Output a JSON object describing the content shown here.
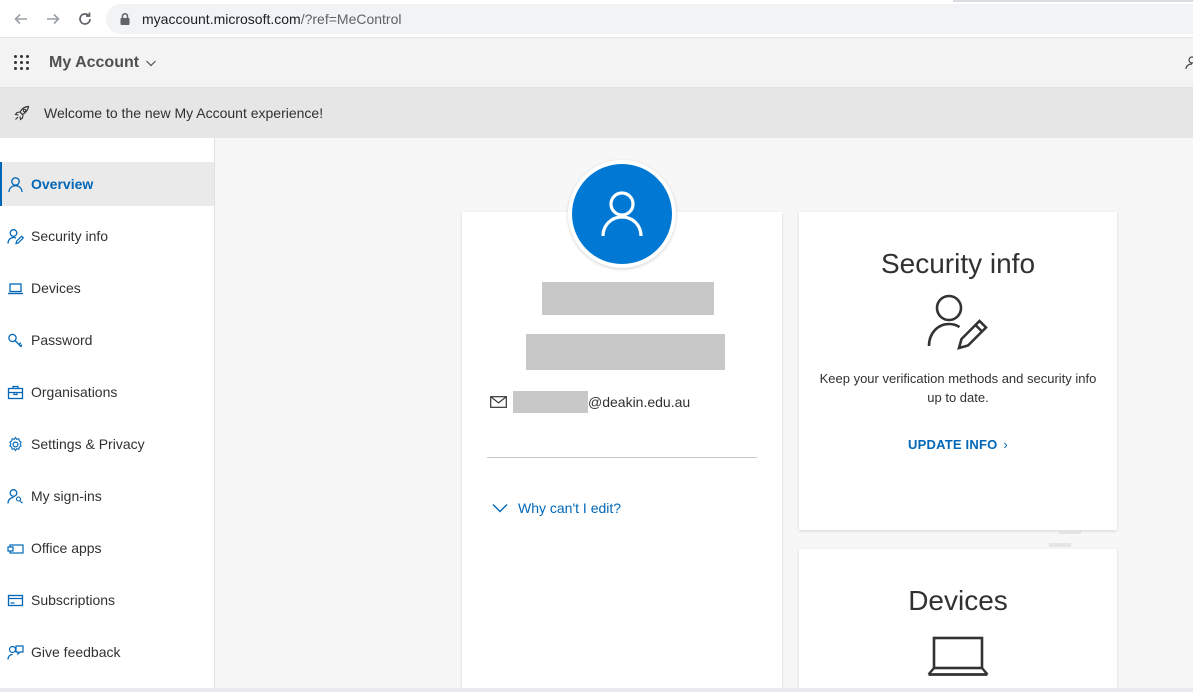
{
  "browser": {
    "url_host": "myaccount.microsoft.com",
    "url_rest": "/?ref=MeControl"
  },
  "header": {
    "app_title": "My Account"
  },
  "banner": {
    "text": "Welcome to the new My Account experience!"
  },
  "sidebar": {
    "items": [
      {
        "label": "Overview",
        "icon": "person-icon",
        "active": true
      },
      {
        "label": "Security info",
        "icon": "person-edit-icon"
      },
      {
        "label": "Devices",
        "icon": "laptop-icon"
      },
      {
        "label": "Password",
        "icon": "key-icon"
      },
      {
        "label": "Organisations",
        "icon": "briefcase-icon"
      },
      {
        "label": "Settings & Privacy",
        "icon": "gear-icon"
      },
      {
        "label": "My sign-ins",
        "icon": "person-key-icon"
      },
      {
        "label": "Office apps",
        "icon": "apps-icon"
      },
      {
        "label": "Subscriptions",
        "icon": "card-icon"
      },
      {
        "label": "Give feedback",
        "icon": "feedback-icon"
      }
    ]
  },
  "profile": {
    "email_domain": "@deakin.edu.au",
    "why_edit": "Why can't I edit?"
  },
  "security_card": {
    "title": "Security info",
    "description": "Keep your verification methods and security info up to date.",
    "link": "UPDATE INFO"
  },
  "devices_card": {
    "title": "Devices"
  },
  "colors": {
    "accent": "#0067b8",
    "avatar": "#0078d4"
  }
}
